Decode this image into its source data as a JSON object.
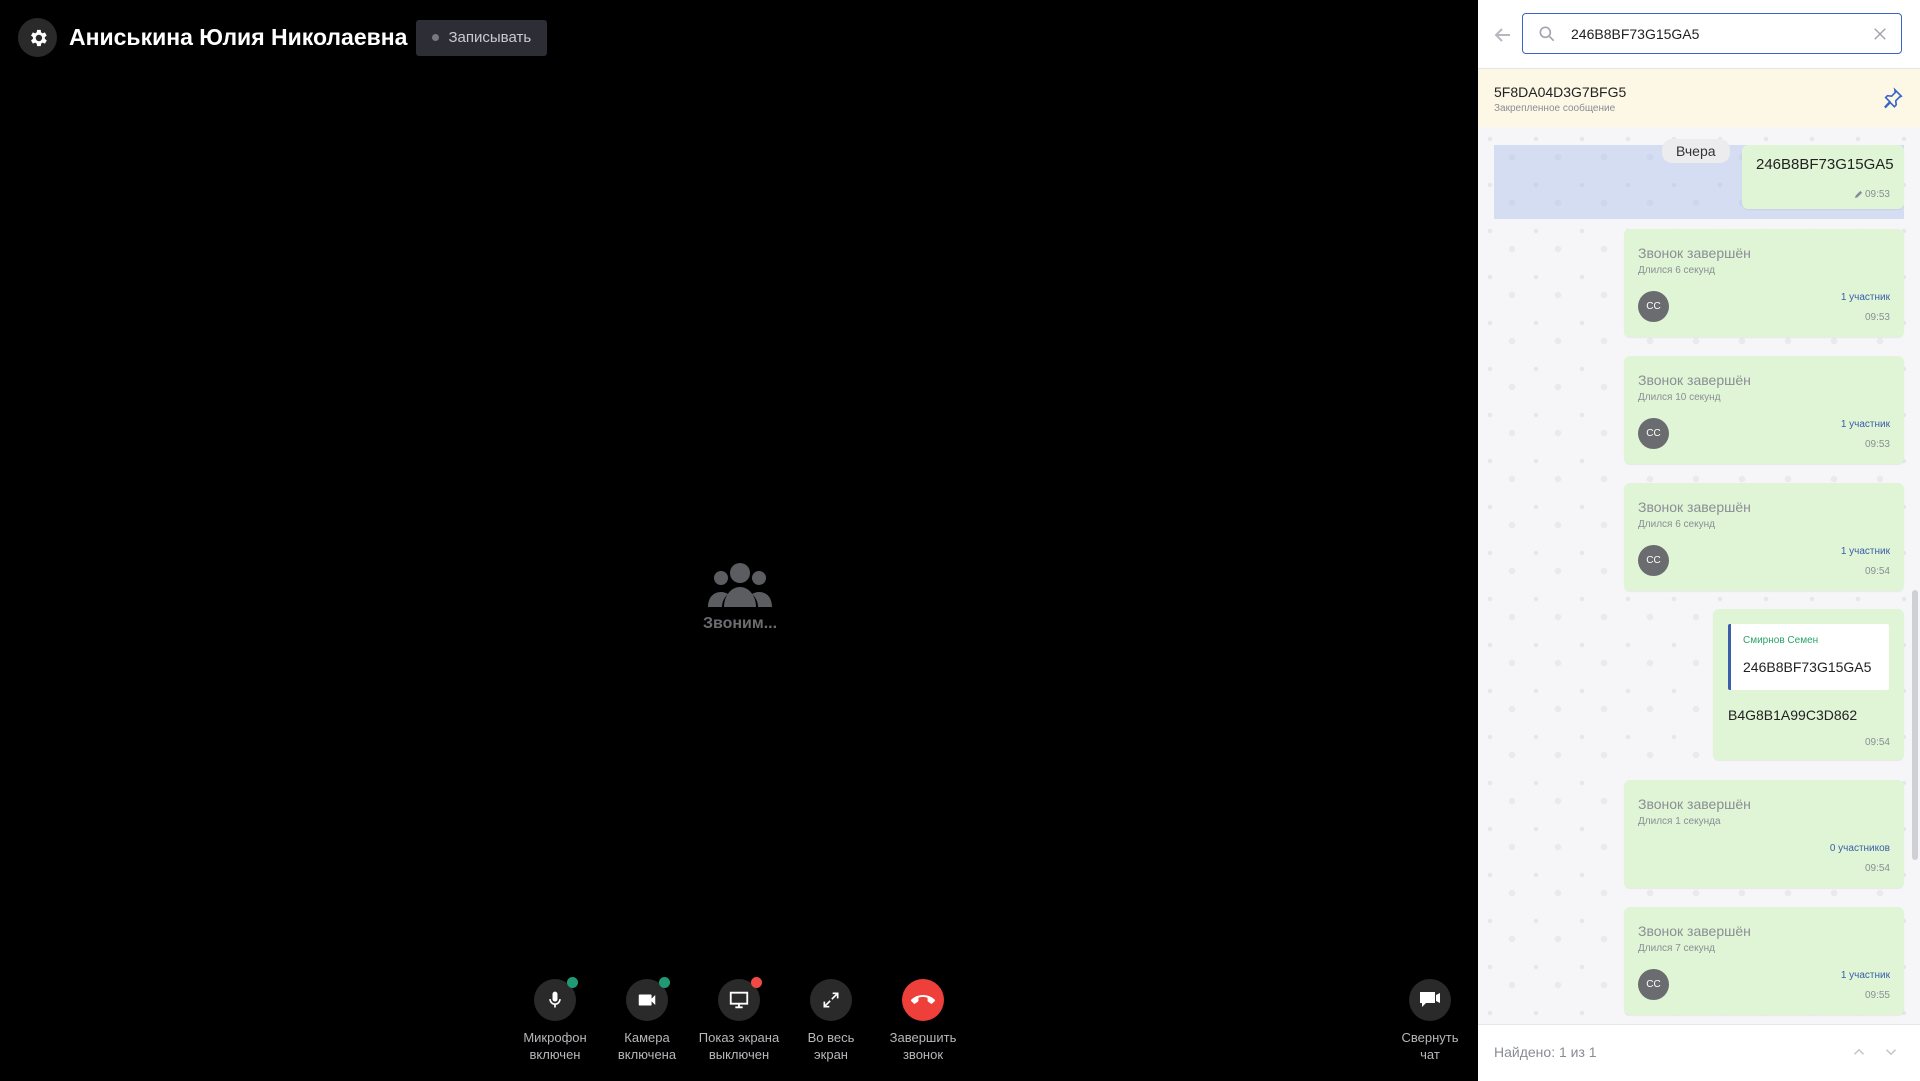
{
  "call": {
    "title": "Аниськина Юлия Николаевна",
    "record_label": "Записывать",
    "status": "Звоним...",
    "controls": [
      {
        "line1": "Микрофон",
        "line2": "включен",
        "badge": "#1f9a74"
      },
      {
        "line1": "Камера",
        "line2": "включена",
        "badge": "#1f9a74"
      },
      {
        "line1": "Показ экрана",
        "line2": "выключен",
        "badge": "#ef4b44"
      },
      {
        "line1": "Во весь",
        "line2": "экран"
      },
      {
        "line1": "Завершить",
        "line2": "звонок"
      }
    ],
    "collapse": {
      "line1": "Свернуть",
      "line2": "чат"
    }
  },
  "search": {
    "value": "246B8BF73G15GA5"
  },
  "pinned": {
    "text": "5F8DA04D3G7BFG5",
    "caption": "Закрепленное сообщение"
  },
  "chat": {
    "day": "Вчера",
    "first_message": {
      "text": "246B8BF73G15GA5",
      "time": "09:53"
    },
    "calls": [
      {
        "title": "Звонок завершён",
        "duration": "Длился 6 секунд",
        "avatar": "СС",
        "participants": "1 участник",
        "time": "09:53"
      },
      {
        "title": "Звонок завершён",
        "duration": "Длился 10 секунд",
        "avatar": "СС",
        "participants": "1 участник",
        "time": "09:53"
      },
      {
        "title": "Звонок завершён",
        "duration": "Длился 6 секунд",
        "avatar": "СС",
        "participants": "1 участник",
        "time": "09:54"
      },
      {
        "title": "Звонок завершён",
        "duration": "Длился 1 секунда",
        "avatar": "",
        "participants": "0 участников",
        "time": "09:54"
      },
      {
        "title": "Звонок завершён",
        "duration": "Длился 7 секунд",
        "avatar": "СС",
        "participants": "1 участник",
        "time": "09:55"
      }
    ],
    "reply": {
      "quote_author": "Смирнов Семен",
      "quote_text": "246B8BF73G15GA5",
      "text": "B4G8B1A99C3D862",
      "time": "09:54"
    }
  },
  "footer": {
    "result": "Найдено: 1 из 1"
  }
}
